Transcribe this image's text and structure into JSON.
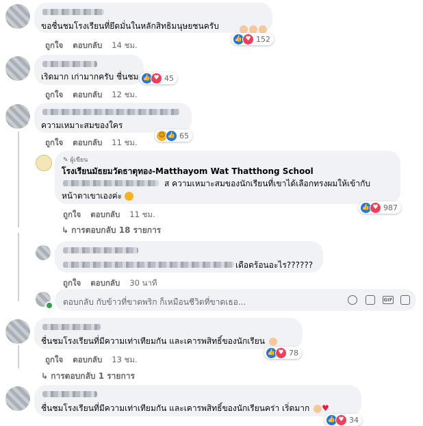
{
  "actions": {
    "like": "ถูกใจ",
    "reply": "ตอบกลับ"
  },
  "comments": [
    {
      "text": "ขอชื่นชมโรงเรียนที่ยึดมั่นในหลักสิทธิมนุษยชนครับ",
      "time": "14 ชม.",
      "reaction_count": "152",
      "reactions": [
        "like-icon",
        "love-icon"
      ]
    },
    {
      "text": "เริดมาก เก่ามากครับ ชื่นชม",
      "time": "12 ชม.",
      "reaction_count": "45",
      "reactions": [
        "like-icon",
        "love-icon"
      ]
    },
    {
      "text": "ความเหมาะสมของใคร",
      "time": "11 ชม.",
      "reaction_count": "65",
      "reactions": [
        "haha-icon",
        "like-icon"
      ]
    }
  ],
  "reply1": {
    "badge": "ผู้เขียน",
    "author": "โรงเรียนมัธยมวัดธาตุทอง-Matthayom Wat Thatthong School",
    "text_line1": "ส ความเหมาะสมของนักเรียนที่เขาได้เลือกทรงผมให้เข้ากับ",
    "text_line2": "หน้าตาเขาเองค่ะ",
    "time": "11 ชม.",
    "reaction_count": "987",
    "reactions": [
      "like-icon",
      "love-icon"
    ]
  },
  "more_replies_1": "↳ การตอบกลับ 18 รายการ",
  "reply2": {
    "text": "เดือดร้อนอะไร??????",
    "time": "30 นาที"
  },
  "reply_input": {
    "placeholder": "ตอบกลับ กับข้าวที่ขาดพริก ก็เหมือนชีวิตที่ขาดเธอ..."
  },
  "comment4": {
    "text": "ชื่นชมโรงเรียนที่มีความเท่าเทียมกัน และเคารพสิทธิ์ของนักเรียน",
    "time": "13 ชม.",
    "reaction_count": "78",
    "reactions": [
      "like-icon",
      "love-icon"
    ]
  },
  "more_replies_2": "↳ การตอบกลับ 1 รายการ",
  "comment5": {
    "text": "ชื่นชมโรงเรียนที่มีความเท่าเทียมกัน และเคารพสิทธิ์ของนักเรียนคร่า เริ่ดมาก",
    "reaction_count": "34",
    "reactions": [
      "like-icon",
      "love-icon"
    ]
  }
}
